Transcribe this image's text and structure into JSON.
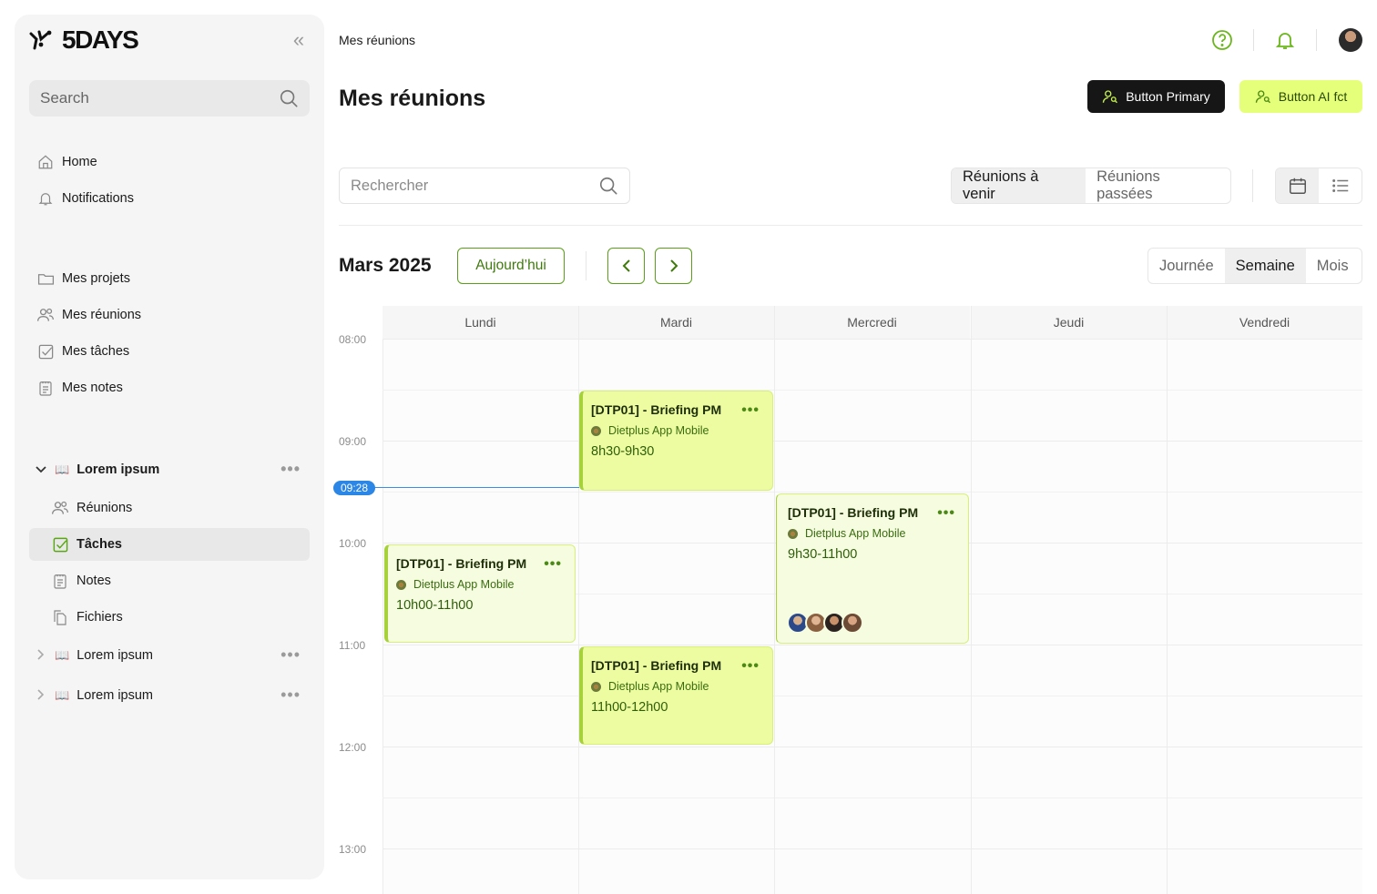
{
  "sidebar": {
    "brand": "5DAYS",
    "search_placeholder": "Search",
    "nav_primary": [
      {
        "label": "Home",
        "icon": "home-icon"
      },
      {
        "label": "Notifications",
        "icon": "bell-icon"
      }
    ],
    "nav_secondary": [
      {
        "label": "Mes projets",
        "icon": "folder-icon"
      },
      {
        "label": "Mes réunions",
        "icon": "users-icon"
      },
      {
        "label": "Mes tâches",
        "icon": "checkbox-icon"
      },
      {
        "label": "Mes notes",
        "icon": "notepad-icon"
      }
    ],
    "workspaces": [
      {
        "label": "Lorem ipsum",
        "emoji": "📖",
        "expanded": true,
        "children": [
          {
            "label": "Réunions",
            "icon": "users-icon"
          },
          {
            "label": "Tâches",
            "icon": "checkbox-icon",
            "active": true
          },
          {
            "label": "Notes",
            "icon": "notepad-icon"
          },
          {
            "label": "Fichiers",
            "icon": "files-icon"
          }
        ]
      },
      {
        "label": "Lorem ipsum",
        "emoji": "📖",
        "expanded": false
      },
      {
        "label": "Lorem ipsum",
        "emoji": "📖",
        "expanded": false
      }
    ]
  },
  "header": {
    "breadcrumb": "Mes réunions",
    "title": "Mes réunions",
    "btn_primary": "Button Primary",
    "btn_ai": "Button AI fct"
  },
  "toolbar": {
    "search_placeholder": "Rechercher",
    "filter_tabs": [
      "Réunions à venir",
      "Réunions passées"
    ],
    "filter_selected": "Réunions à venir",
    "view_selected": "calendar"
  },
  "calendar": {
    "month": "Mars 2025",
    "today_label": "Aujourd’hui",
    "periods": [
      "Journée",
      "Semaine",
      "Mois"
    ],
    "period_selected": "Semaine",
    "days": [
      "Lundi",
      "Mardi",
      "Mercredi",
      "Jeudi",
      "Vendredi"
    ],
    "hours": [
      "08:00",
      "09:00",
      "10:00",
      "11:00",
      "12:00",
      "13:00"
    ],
    "now": "09:28",
    "events": [
      {
        "title": "[DTP01] - Briefing PM",
        "project": "Dietplus App Mobile",
        "time": "8h30-9h30"
      },
      {
        "title": "[DTP01] - Briefing PM",
        "project": "Dietplus App Mobile",
        "time": "9h30-11h00"
      },
      {
        "title": "[DTP01] - Briefing PM",
        "project": "Dietplus App Mobile",
        "time": "10h00-11h00"
      },
      {
        "title": "[DTP01] - Briefing PM",
        "project": "Dietplus App Mobile",
        "time": "11h00-12h00"
      }
    ]
  },
  "colors": {
    "accent_green": "#5a9e1a",
    "ai_button": "#e6ff7a",
    "event_bg": "#edfca0",
    "now_indicator": "#2b86e6"
  }
}
